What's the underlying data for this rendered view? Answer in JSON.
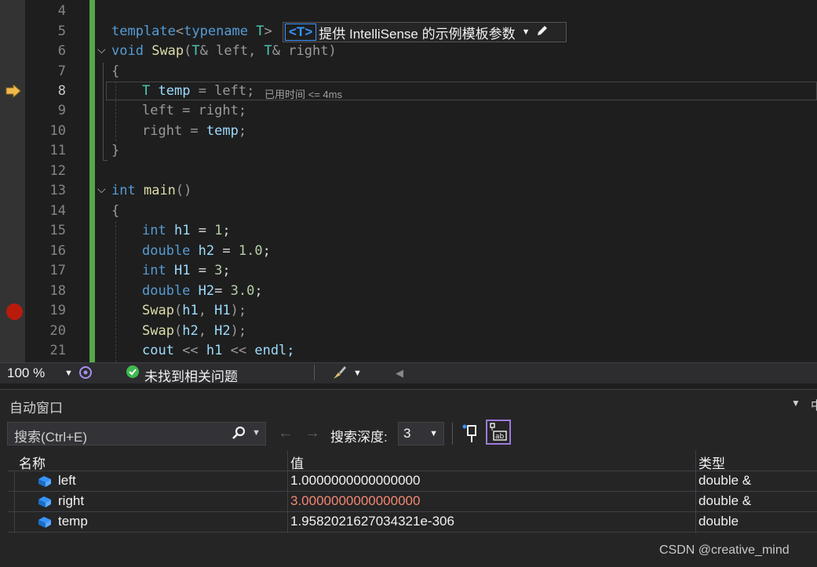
{
  "editor": {
    "line_numbers": [
      "4",
      "5",
      "6",
      "7",
      "8",
      "9",
      "10",
      "11",
      "12",
      "13",
      "14",
      "15",
      "16",
      "17",
      "18",
      "19",
      "20",
      "21"
    ],
    "current_line": "8",
    "breakpoint_line": "19",
    "elapsed_text": "已用时间 <= 4ms",
    "intellisense": {
      "tag": "<T>",
      "label": "提供 IntelliSense 的示例模板参数",
      "dropdown_icon": "chevron-down-icon",
      "edit_icon": "pencil-icon"
    },
    "code": {
      "l5_template": "template",
      "l5_lt": "<",
      "l5_typename": "typename",
      "l5_T": " T",
      "l5_gt": ">",
      "l6_void": "void",
      "l6_swap": "Swap",
      "l6_open": "(",
      "l6_T1": "T",
      "l6_left": "& left, ",
      "l6_T2": "T",
      "l6_right": "& right)",
      "l7": "{",
      "l8_T": "T",
      "l8_temp": "temp",
      "l8_rest": " = left;",
      "l9": "left = right;",
      "l10_a": "right = ",
      "l10_b": "temp",
      "l10_c": ";",
      "l11": "}",
      "l13_int": "int",
      "l13_main": "main",
      "l13_rest": "()",
      "l14": "{",
      "l15_kw": "int",
      "l15_var": "h1",
      "l15_eq": " = ",
      "l15_num": "1",
      "l15_end": ";",
      "l16_kw": "double",
      "l16_var": "h2",
      "l16_eq": " = ",
      "l16_num": "1.0",
      "l16_end": ";",
      "l17_kw": "int",
      "l17_var": "H1",
      "l17_eq": " = ",
      "l17_num": "3",
      "l17_end": ";",
      "l18_kw": "double",
      "l18_var": "H2",
      "l18_eq": "= ",
      "l18_num": "3.0",
      "l18_end": ";",
      "l19_fn": "Swap",
      "l19_a": "(",
      "l19_v1": "h1",
      "l19_b": ", ",
      "l19_v2": "H1",
      "l19_c": ");",
      "l20_fn": "Swap",
      "l20_a": "(",
      "l20_v1": "h2",
      "l20_b": ", ",
      "l20_v2": "H2",
      "l20_c": ");",
      "l21_a": "cout ",
      "l21_b": "<<",
      "l21_v": " h1 ",
      "l21_c": "<<",
      "l21_d": " endl;"
    }
  },
  "statusbar": {
    "zoom": "100 %",
    "issues": "未找到相关问题"
  },
  "autos": {
    "title": "自动窗口",
    "search_placeholder": "搜索(Ctrl+E)",
    "depth_label": "搜索深度:",
    "depth_value": "3",
    "columns": {
      "name": "名称",
      "value": "值",
      "type": "类型"
    },
    "rows": [
      {
        "name": "left",
        "value": "1.0000000000000000",
        "type": "double &",
        "changed": false
      },
      {
        "name": "right",
        "value": "3.0000000000000000",
        "type": "double &",
        "changed": true
      },
      {
        "name": "temp",
        "value": "1.9582021627034321e-306",
        "type": "double",
        "changed": false
      }
    ],
    "changed_color": "#f48771"
  },
  "watermark": "CSDN @creative_mind"
}
